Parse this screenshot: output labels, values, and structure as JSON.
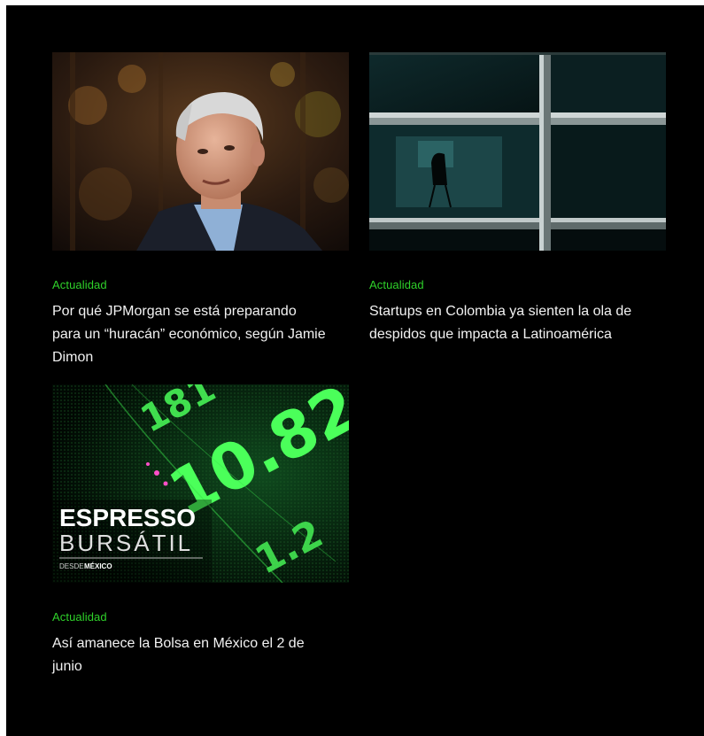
{
  "articles": [
    {
      "category": "Actualidad",
      "title": "Por qué JPMorgan se está preparando para un “huracán” económico, según Jamie Dimon",
      "image": "portrait-photo"
    },
    {
      "category": "Actualidad",
      "title": "Startups en Colombia ya sienten la ola de despidos que impacta a Latinoamérica",
      "image": "office-window-photo"
    },
    {
      "category": "Actualidad",
      "title": "Así amanece la Bolsa en México el 2 de junio",
      "image": "stock-ticker-graphic",
      "image_text": {
        "line1": "ESPRESSO",
        "line2": "BURSÁTIL",
        "line3a": "DESDE",
        "line3b": "MÉXICO",
        "ticker": [
          "181",
          "10.82",
          "1.2"
        ]
      }
    }
  ],
  "colors": {
    "background": "#000000",
    "category": "#2fd12a",
    "title": "#f2f2f2"
  }
}
